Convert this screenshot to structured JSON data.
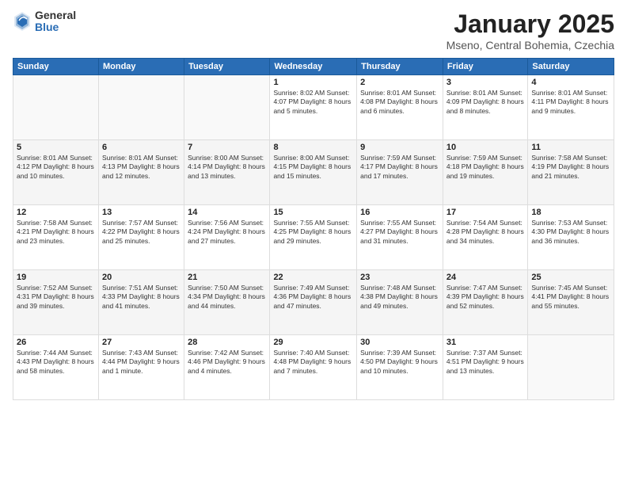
{
  "header": {
    "logo_general": "General",
    "logo_blue": "Blue",
    "title": "January 2025",
    "location": "Mseno, Central Bohemia, Czechia"
  },
  "days_of_week": [
    "Sunday",
    "Monday",
    "Tuesday",
    "Wednesday",
    "Thursday",
    "Friday",
    "Saturday"
  ],
  "weeks": [
    {
      "days": [
        {
          "num": "",
          "info": ""
        },
        {
          "num": "",
          "info": ""
        },
        {
          "num": "",
          "info": ""
        },
        {
          "num": "1",
          "info": "Sunrise: 8:02 AM\nSunset: 4:07 PM\nDaylight: 8 hours\nand 5 minutes."
        },
        {
          "num": "2",
          "info": "Sunrise: 8:01 AM\nSunset: 4:08 PM\nDaylight: 8 hours\nand 6 minutes."
        },
        {
          "num": "3",
          "info": "Sunrise: 8:01 AM\nSunset: 4:09 PM\nDaylight: 8 hours\nand 8 minutes."
        },
        {
          "num": "4",
          "info": "Sunrise: 8:01 AM\nSunset: 4:11 PM\nDaylight: 8 hours\nand 9 minutes."
        }
      ]
    },
    {
      "days": [
        {
          "num": "5",
          "info": "Sunrise: 8:01 AM\nSunset: 4:12 PM\nDaylight: 8 hours\nand 10 minutes."
        },
        {
          "num": "6",
          "info": "Sunrise: 8:01 AM\nSunset: 4:13 PM\nDaylight: 8 hours\nand 12 minutes."
        },
        {
          "num": "7",
          "info": "Sunrise: 8:00 AM\nSunset: 4:14 PM\nDaylight: 8 hours\nand 13 minutes."
        },
        {
          "num": "8",
          "info": "Sunrise: 8:00 AM\nSunset: 4:15 PM\nDaylight: 8 hours\nand 15 minutes."
        },
        {
          "num": "9",
          "info": "Sunrise: 7:59 AM\nSunset: 4:17 PM\nDaylight: 8 hours\nand 17 minutes."
        },
        {
          "num": "10",
          "info": "Sunrise: 7:59 AM\nSunset: 4:18 PM\nDaylight: 8 hours\nand 19 minutes."
        },
        {
          "num": "11",
          "info": "Sunrise: 7:58 AM\nSunset: 4:19 PM\nDaylight: 8 hours\nand 21 minutes."
        }
      ]
    },
    {
      "days": [
        {
          "num": "12",
          "info": "Sunrise: 7:58 AM\nSunset: 4:21 PM\nDaylight: 8 hours\nand 23 minutes."
        },
        {
          "num": "13",
          "info": "Sunrise: 7:57 AM\nSunset: 4:22 PM\nDaylight: 8 hours\nand 25 minutes."
        },
        {
          "num": "14",
          "info": "Sunrise: 7:56 AM\nSunset: 4:24 PM\nDaylight: 8 hours\nand 27 minutes."
        },
        {
          "num": "15",
          "info": "Sunrise: 7:55 AM\nSunset: 4:25 PM\nDaylight: 8 hours\nand 29 minutes."
        },
        {
          "num": "16",
          "info": "Sunrise: 7:55 AM\nSunset: 4:27 PM\nDaylight: 8 hours\nand 31 minutes."
        },
        {
          "num": "17",
          "info": "Sunrise: 7:54 AM\nSunset: 4:28 PM\nDaylight: 8 hours\nand 34 minutes."
        },
        {
          "num": "18",
          "info": "Sunrise: 7:53 AM\nSunset: 4:30 PM\nDaylight: 8 hours\nand 36 minutes."
        }
      ]
    },
    {
      "days": [
        {
          "num": "19",
          "info": "Sunrise: 7:52 AM\nSunset: 4:31 PM\nDaylight: 8 hours\nand 39 minutes."
        },
        {
          "num": "20",
          "info": "Sunrise: 7:51 AM\nSunset: 4:33 PM\nDaylight: 8 hours\nand 41 minutes."
        },
        {
          "num": "21",
          "info": "Sunrise: 7:50 AM\nSunset: 4:34 PM\nDaylight: 8 hours\nand 44 minutes."
        },
        {
          "num": "22",
          "info": "Sunrise: 7:49 AM\nSunset: 4:36 PM\nDaylight: 8 hours\nand 47 minutes."
        },
        {
          "num": "23",
          "info": "Sunrise: 7:48 AM\nSunset: 4:38 PM\nDaylight: 8 hours\nand 49 minutes."
        },
        {
          "num": "24",
          "info": "Sunrise: 7:47 AM\nSunset: 4:39 PM\nDaylight: 8 hours\nand 52 minutes."
        },
        {
          "num": "25",
          "info": "Sunrise: 7:45 AM\nSunset: 4:41 PM\nDaylight: 8 hours\nand 55 minutes."
        }
      ]
    },
    {
      "days": [
        {
          "num": "26",
          "info": "Sunrise: 7:44 AM\nSunset: 4:43 PM\nDaylight: 8 hours\nand 58 minutes."
        },
        {
          "num": "27",
          "info": "Sunrise: 7:43 AM\nSunset: 4:44 PM\nDaylight: 9 hours\nand 1 minute."
        },
        {
          "num": "28",
          "info": "Sunrise: 7:42 AM\nSunset: 4:46 PM\nDaylight: 9 hours\nand 4 minutes."
        },
        {
          "num": "29",
          "info": "Sunrise: 7:40 AM\nSunset: 4:48 PM\nDaylight: 9 hours\nand 7 minutes."
        },
        {
          "num": "30",
          "info": "Sunrise: 7:39 AM\nSunset: 4:50 PM\nDaylight: 9 hours\nand 10 minutes."
        },
        {
          "num": "31",
          "info": "Sunrise: 7:37 AM\nSunset: 4:51 PM\nDaylight: 9 hours\nand 13 minutes."
        },
        {
          "num": "",
          "info": ""
        }
      ]
    }
  ]
}
